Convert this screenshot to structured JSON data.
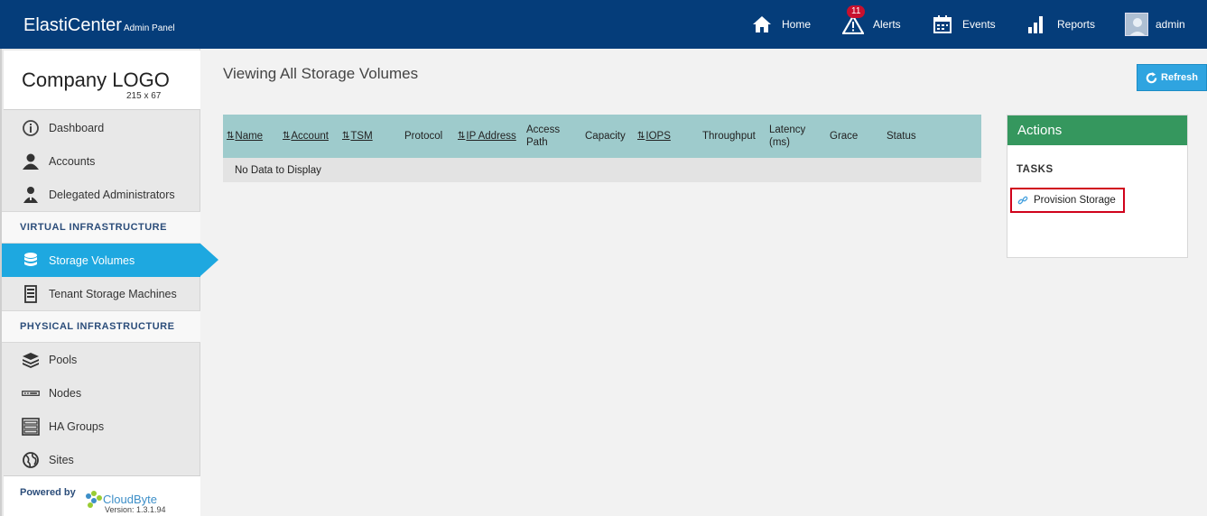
{
  "header": {
    "brand": "ElastiCenter",
    "brand_sub": "Admin Panel",
    "nav": [
      {
        "label": "Home",
        "icon": "home-icon"
      },
      {
        "label": "Alerts",
        "icon": "warning-icon",
        "badge": "11"
      },
      {
        "label": "Events",
        "icon": "calendar-icon"
      },
      {
        "label": "Reports",
        "icon": "bar-chart-icon"
      },
      {
        "label": "admin",
        "icon": "user-avatar"
      }
    ]
  },
  "sidebar": {
    "logo_text": "Company LOGO",
    "logo_dims": "215 x 67",
    "items_top": [
      {
        "label": "Dashboard",
        "icon": "info-circle-icon"
      },
      {
        "label": "Accounts",
        "icon": "user-icon"
      },
      {
        "label": "Delegated Administrators",
        "icon": "admin-icon"
      }
    ],
    "section_virtual": "VIRTUAL INFRASTRUCTURE",
    "items_virtual": [
      {
        "label": "Storage Volumes",
        "icon": "database-icon",
        "active": true
      },
      {
        "label": "Tenant Storage Machines",
        "icon": "server-icon"
      }
    ],
    "section_physical": "PHYSICAL INFRASTRUCTURE",
    "items_physical": [
      {
        "label": "Pools",
        "icon": "layers-icon"
      },
      {
        "label": "Nodes",
        "icon": "node-icon"
      },
      {
        "label": "HA Groups",
        "icon": "rack-icon"
      },
      {
        "label": "Sites",
        "icon": "globe-icon"
      }
    ],
    "powered_by": "Powered by",
    "vendor": "CloudByte",
    "version": "Version: 1.3.1.94"
  },
  "main": {
    "title": "Viewing All Storage Volumes",
    "refresh_label": "Refresh",
    "columns": [
      {
        "label": "Name",
        "sortable": true
      },
      {
        "label": "Account",
        "sortable": true
      },
      {
        "label": "TSM",
        "sortable": true
      },
      {
        "label": "Protocol",
        "sortable": false
      },
      {
        "label": "IP Address",
        "sortable": true
      },
      {
        "label": "Access Path",
        "sortable": false
      },
      {
        "label": "Capacity",
        "sortable": false
      },
      {
        "label": "IOPS",
        "sortable": true
      },
      {
        "label": "Throughput",
        "sortable": false
      },
      {
        "label": "Latency (ms)",
        "sortable": false
      },
      {
        "label": "Grace",
        "sortable": false
      },
      {
        "label": "Status",
        "sortable": false
      }
    ],
    "empty_text": "No Data to Display"
  },
  "actions": {
    "title": "Actions",
    "tasks_label": "TASKS",
    "task_link": "Provision Storage"
  },
  "colors": {
    "topbar": "#053d7a",
    "active": "#1ea8e0",
    "grid_header": "#9ecbcc",
    "actions_header": "#35975e",
    "highlight": "#d0021b"
  }
}
